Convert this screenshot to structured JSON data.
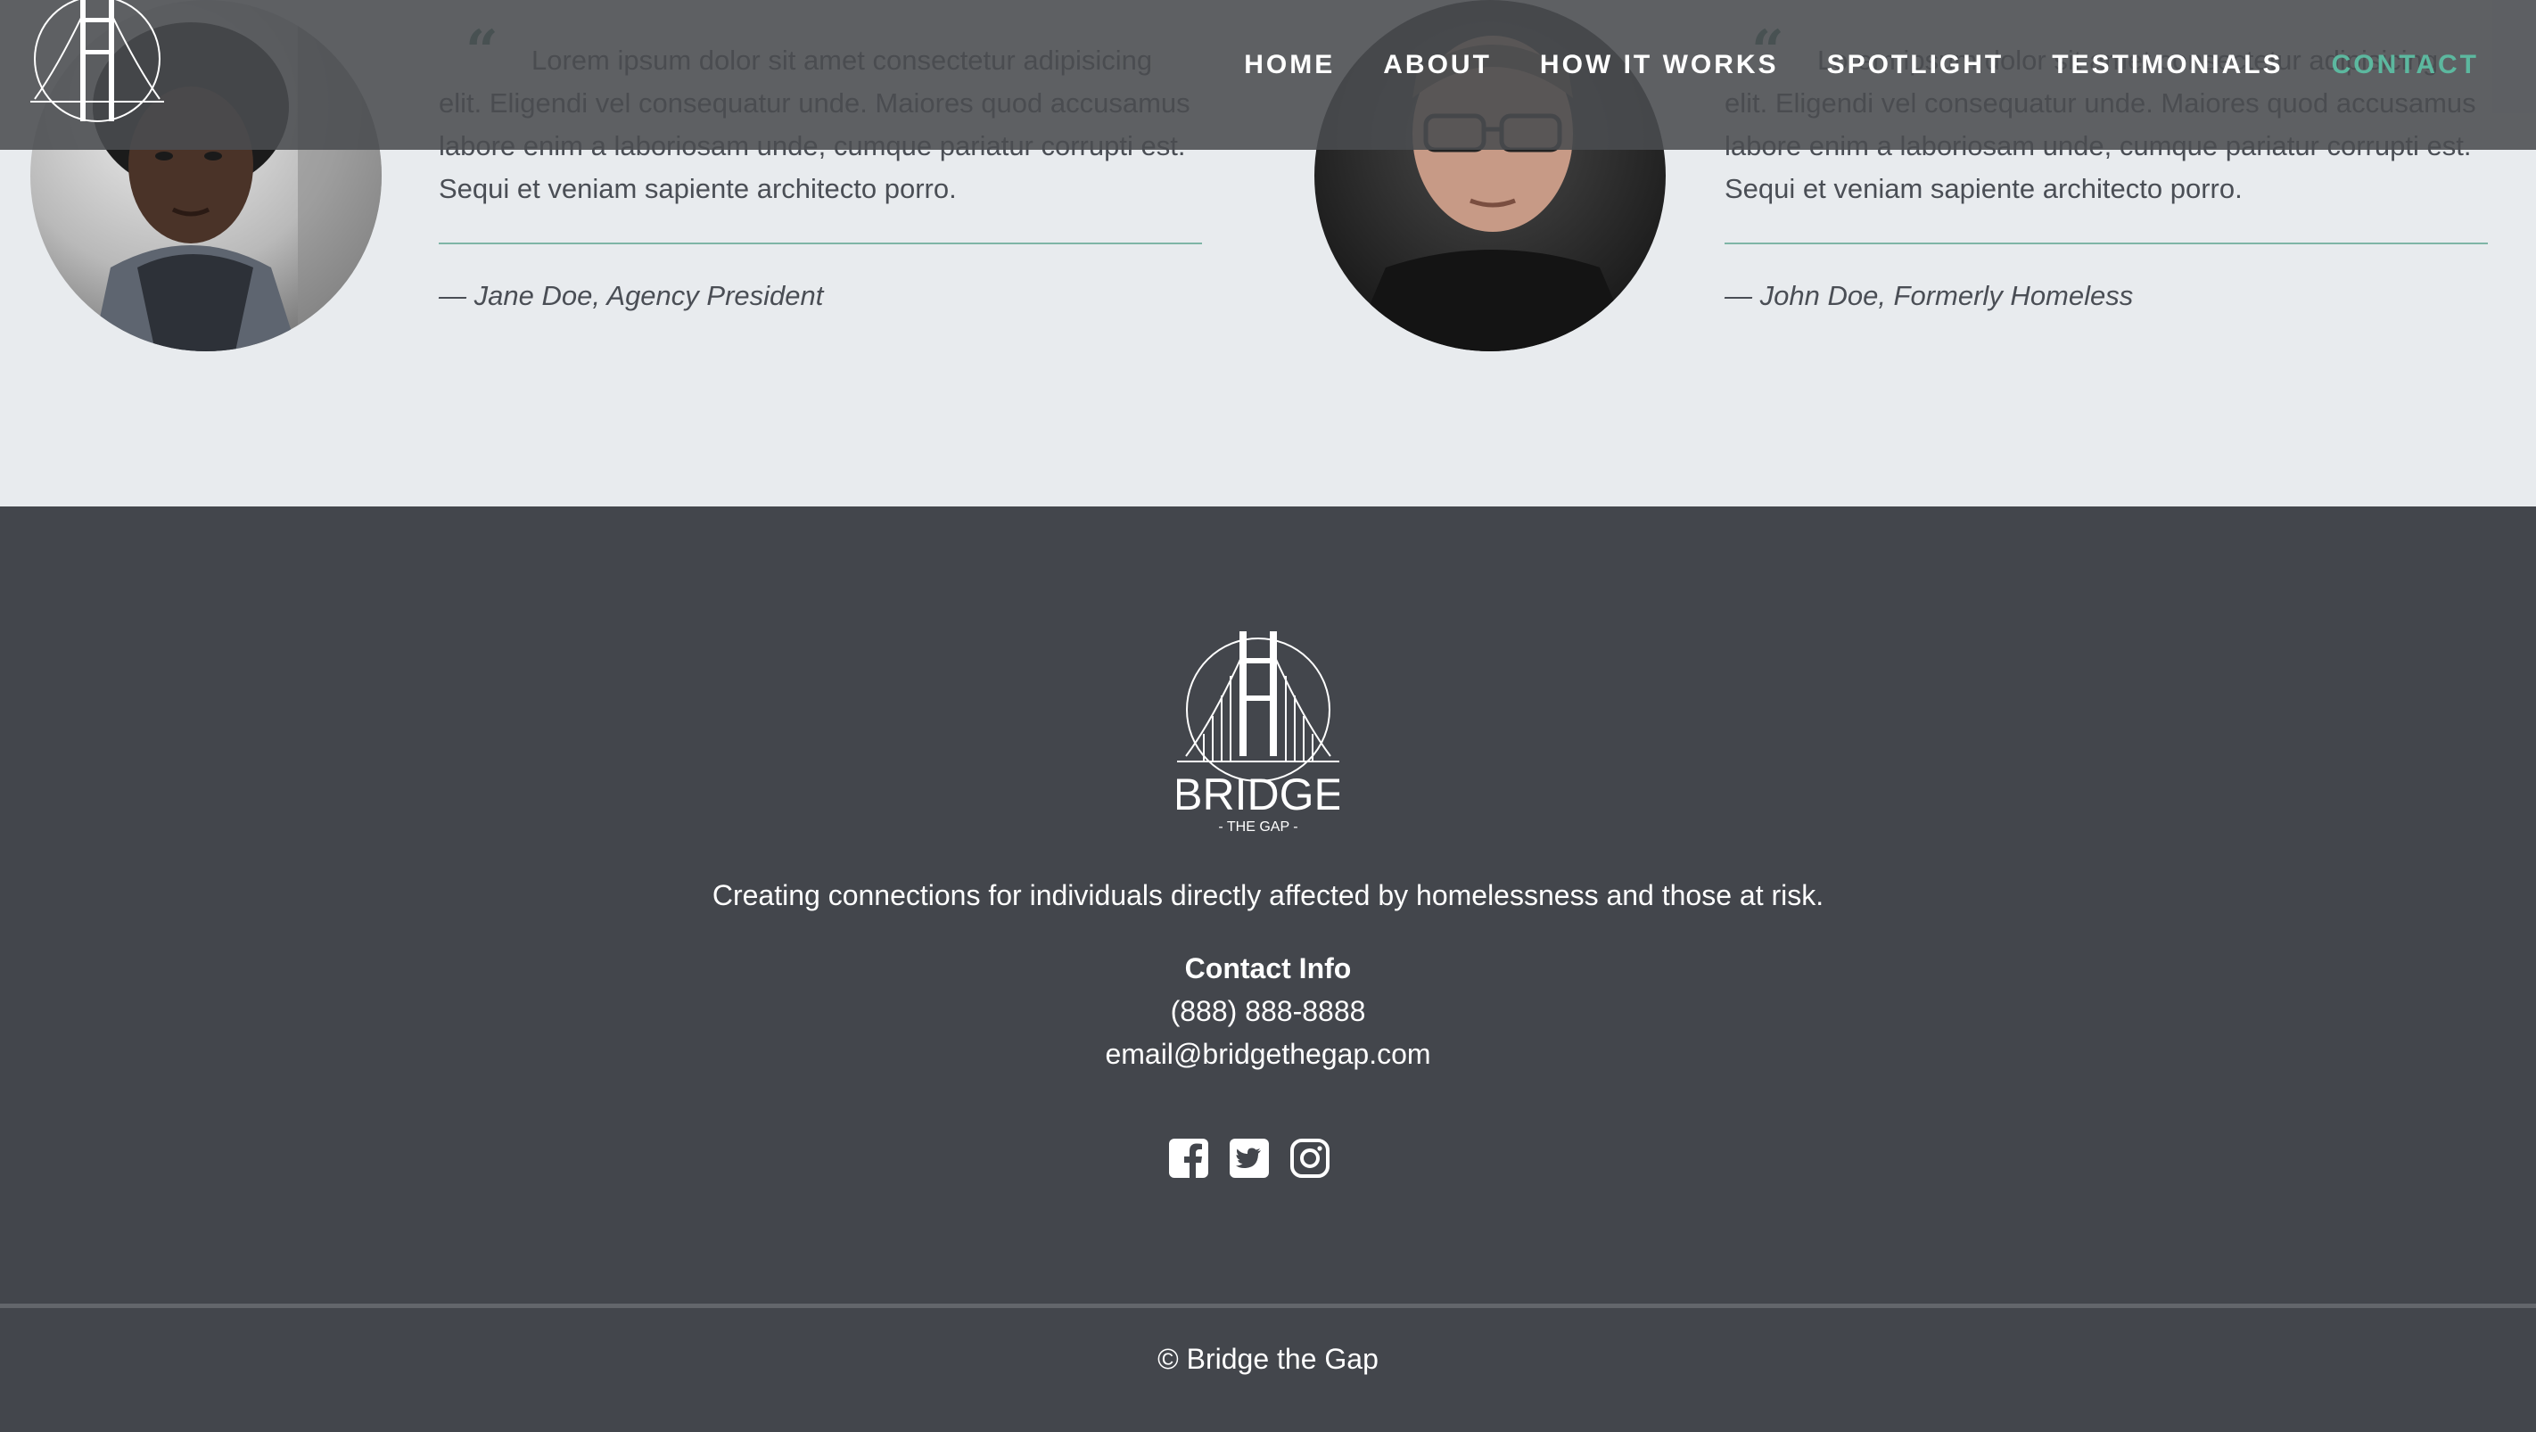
{
  "nav": {
    "items": [
      {
        "label": "HOME",
        "active": false
      },
      {
        "label": "ABOUT",
        "active": false
      },
      {
        "label": "HOW IT WORKS",
        "active": false
      },
      {
        "label": "SPOTLIGHT",
        "active": false
      },
      {
        "label": "TESTIMONIALS",
        "active": false
      },
      {
        "label": "CONTACT",
        "active": true
      }
    ],
    "logo_icon": "bridge-logo-icon"
  },
  "testimonials": [
    {
      "quote": "Lorem ipsum dolor sit amet consectetur adipisicing elit. Eligendi vel consequatur unde. Maiores quod accusamus labore enim a laboriosam unde, cumque pariatur corrupti est. Sequi et veniam sapiente architecto porro.",
      "attribution": "— Jane Doe, Agency President",
      "photo": "woman-portrait"
    },
    {
      "quote": "Lorem ipsum dolor sit amet consectetur adipisicing elit. Eligendi vel consequatur unde. Maiores quod accusamus labore enim a laboriosam unde, cumque pariatur corrupti est. Sequi et veniam sapiente architecto porro.",
      "attribution": "— John Doe, Formerly Homeless",
      "photo": "man-portrait"
    }
  ],
  "footer": {
    "logo": {
      "name": "BRIDGE",
      "sub": "- THE GAP -"
    },
    "tagline": "Creating connections for individuals directly affected by homelessness and those at risk.",
    "contact_heading": "Contact Info",
    "phone": "(888) 888-8888",
    "email": "email@bridgethegap.com",
    "socials": [
      "facebook-icon",
      "twitter-icon",
      "instagram-icon"
    ],
    "copyright": "© Bridge the Gap"
  },
  "colors": {
    "accent": "#5cb89f",
    "footer_bg": "#43464c",
    "section_bg": "#e8ebee",
    "quote_mark": "#3f7466"
  }
}
